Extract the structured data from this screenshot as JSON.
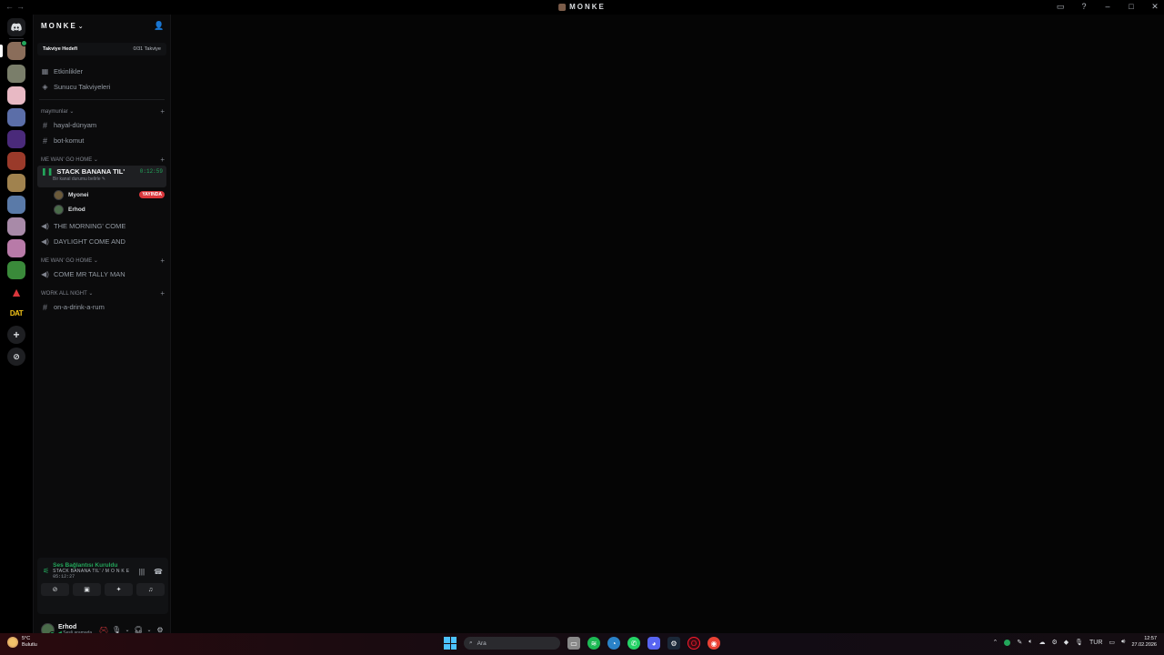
{
  "window": {
    "title": "MONKE",
    "nav": "←→"
  },
  "server": {
    "name": "MONKE",
    "boost_goal_label": "Takviye Hedefi",
    "boost_goal_count": "0/31 Takviye"
  },
  "nav_items": [
    {
      "label": "Etkinlikler"
    },
    {
      "label": "Sunucu Takviyeleri"
    }
  ],
  "categories": {
    "c1": {
      "label": "maymunlar"
    },
    "c2": {
      "label": "ME WAN' GO HOME"
    },
    "c3": {
      "label": "ME WAN' GO HOME"
    },
    "c4": {
      "label": "WORK ALL NIGHT"
    }
  },
  "channels": {
    "hayal": "hayal-dünyam",
    "bot": "bot-komut",
    "stack": "STACK BANANA TIL'",
    "stack_timer": "0:12:59",
    "stack_status": "Bir kanal durumu belirle",
    "morning": "THE MORNING' COME",
    "daylight": "DAYLIGHT COME AND",
    "tally": "COME MR TALLY MAN",
    "drink": "on-a-drink-a-rum"
  },
  "voice_users": [
    {
      "name": "Myonei",
      "badge": "YAYINDA"
    },
    {
      "name": "Erhod"
    }
  ],
  "voice_panel": {
    "title": "Ses Bağlantısı Kuruldu",
    "subtitle": "STACK BANANA TIL' / M O N K E",
    "time": "05:12:27"
  },
  "user_panel": {
    "name": "Erhod",
    "status": "Sesli aramada"
  },
  "taskbar": {
    "temp": "5°C",
    "weather": "Bulutlu",
    "search_placeholder": "Ara",
    "lang": "TUR",
    "time": "12:57",
    "date": "27.02.2026"
  },
  "colors": {
    "accent_green": "#23a55a",
    "live_red": "#da373c",
    "background": "#000000"
  }
}
